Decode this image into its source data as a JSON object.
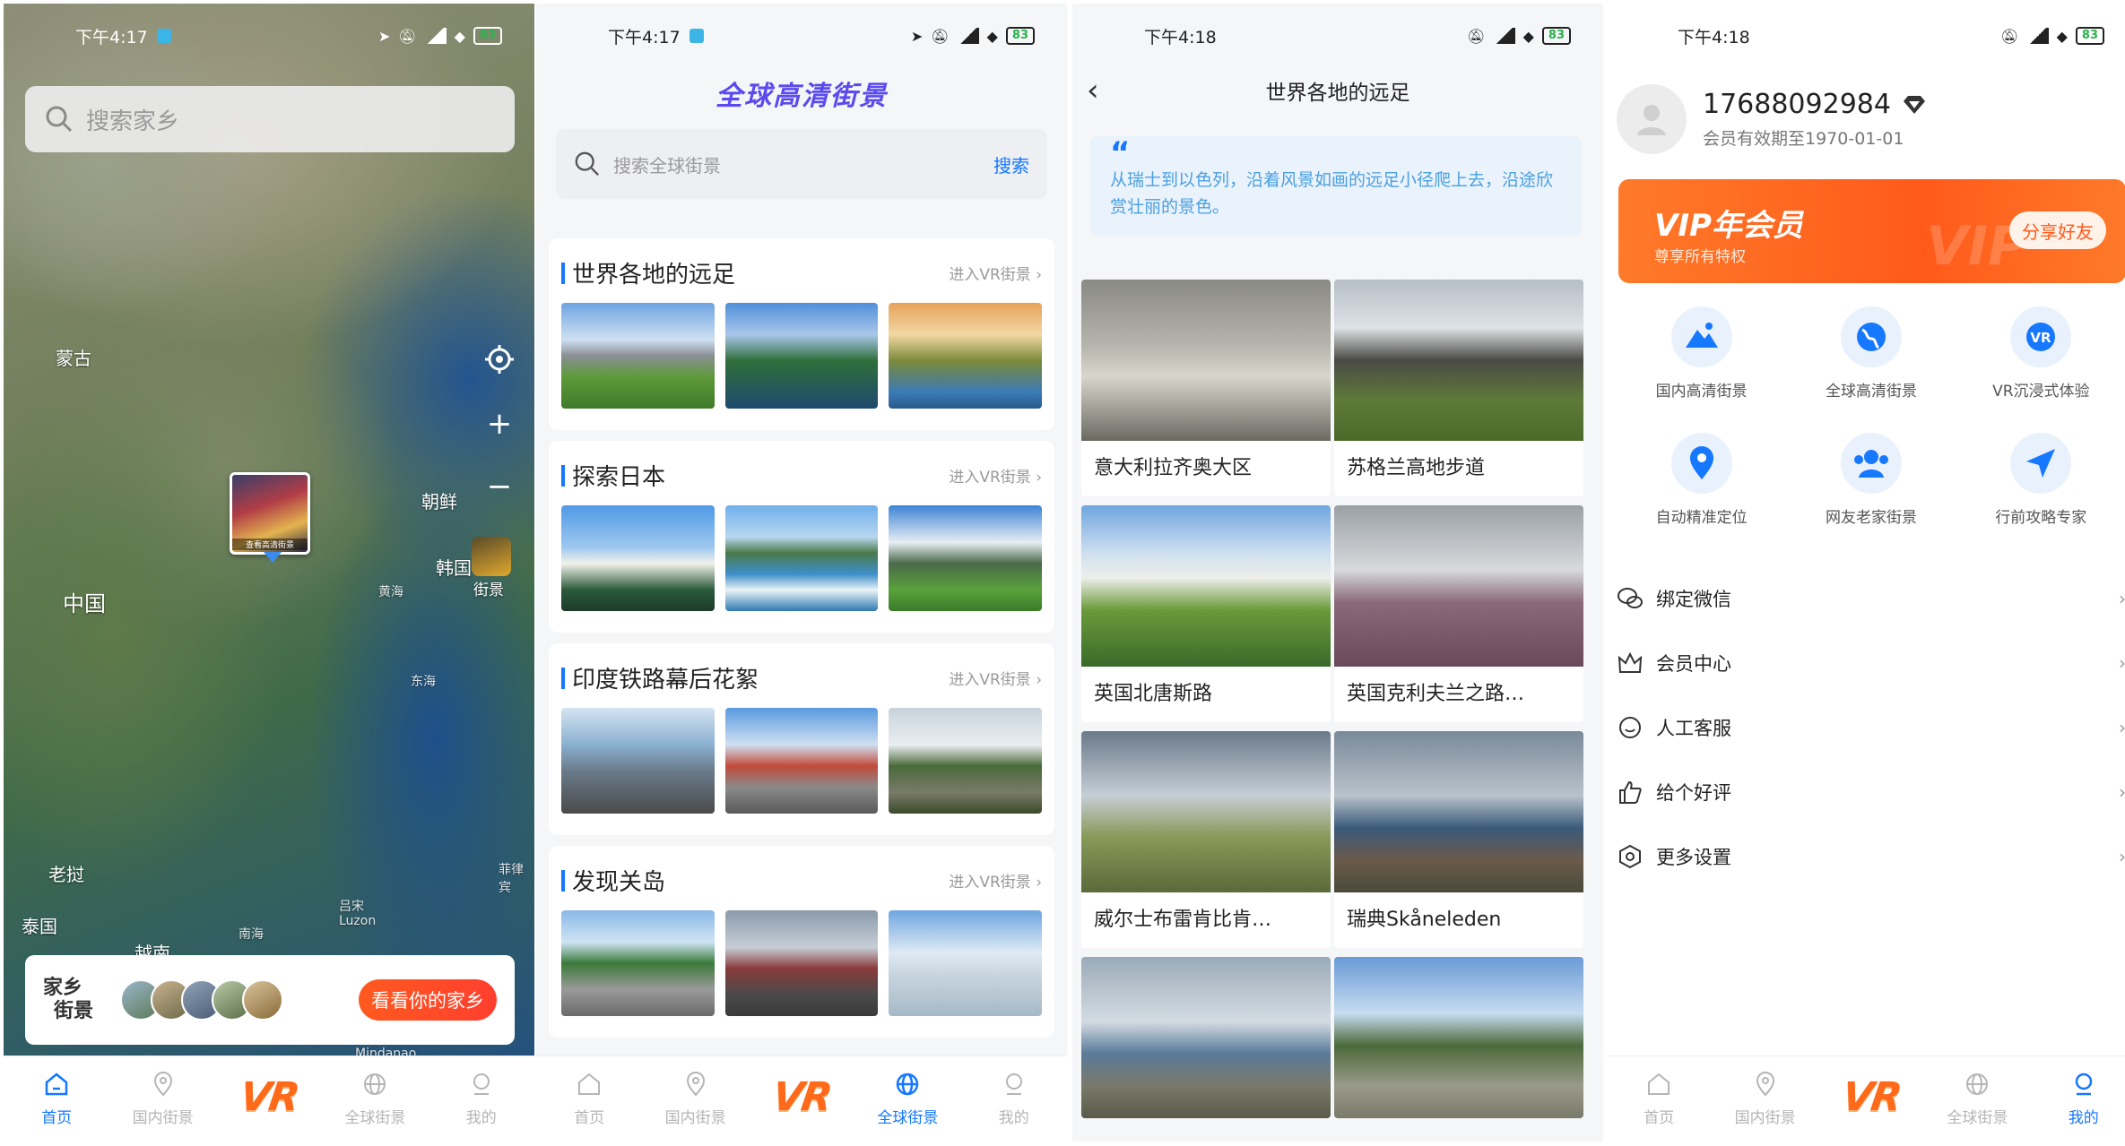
{
  "colors": {
    "accent": "#1677ff",
    "vr_orange": "#ff6a1a",
    "vip_orange": "#ff5a1a",
    "inactive": "#b5b5b5"
  },
  "tabbar": {
    "home": "首页",
    "domestic": "国内街景",
    "vr": "VR",
    "global": "全球街景",
    "mine": "我的"
  },
  "phone1": {
    "status": {
      "time": "下午4:17",
      "battery": "83"
    },
    "search": {
      "placeholder": "搜索家乡"
    },
    "map_labels": {
      "mongolia": "蒙古",
      "china": "中国",
      "korea_n": "朝鲜",
      "korea_s": "韩国",
      "yellow_sea": "黄海",
      "east_sea": "东海",
      "laos": "老挝",
      "thailand": "泰国",
      "vietnam": "越南",
      "south_sea": "南海",
      "luzon": "吕宋\nLuzon",
      "philippines": "菲律宾",
      "mindanao": "Mindanao",
      "street": "街景"
    },
    "pin_caption": "查看高清街景",
    "home_card": {
      "logo_line1": "家乡",
      "logo_line2": "街景",
      "button": "看看你的家乡"
    }
  },
  "phone2": {
    "status": {
      "time": "下午4:17",
      "battery": "83"
    },
    "title": "全球高清街景",
    "search": {
      "placeholder": "搜索全球街景",
      "button": "搜索"
    },
    "enter_label": "进入VR街景 ›",
    "sections": [
      {
        "name": "世界各地的远足"
      },
      {
        "name": "探索日本"
      },
      {
        "name": "印度铁路幕后花絮"
      },
      {
        "name": "发现关岛"
      }
    ]
  },
  "phone3": {
    "status": {
      "time": "下午4:18",
      "battery": "83"
    },
    "title": "世界各地的远足",
    "quote": "从瑞士到以色列，沿着风景如画的远足小径爬上去，沿途欣赏壮丽的景色。",
    "cards": [
      {
        "label": "意大利拉齐奥大区"
      },
      {
        "label": "苏格兰高地步道"
      },
      {
        "label": "英国北唐斯路"
      },
      {
        "label": "英国克利夫兰之路…"
      },
      {
        "label": "威尔士布雷肯比肯…"
      },
      {
        "label": "瑞典Skåneleden"
      },
      {
        "label": ""
      },
      {
        "label": ""
      }
    ]
  },
  "phone4": {
    "status": {
      "time": "下午4:18",
      "battery": "83"
    },
    "phone_number": "17688092984",
    "expiry": "会员有效期至1970-01-01",
    "vip": {
      "title": "VIP年会员",
      "subtitle": "尊享所有特权",
      "share": "分享好友",
      "ghost": "VIP"
    },
    "features": [
      {
        "label": "国内高清街景",
        "icon": "mountain-icon"
      },
      {
        "label": "全球高清街景",
        "icon": "globe-icon"
      },
      {
        "label": "VR沉浸式体验",
        "icon": "vr-icon"
      },
      {
        "label": "自动精准定位",
        "icon": "location-pin-icon"
      },
      {
        "label": "网友老家街景",
        "icon": "users-icon"
      },
      {
        "label": "行前攻略专家",
        "icon": "paper-plane-icon"
      }
    ],
    "menu": [
      {
        "label": "绑定微信",
        "icon": "wechat-icon"
      },
      {
        "label": "会员中心",
        "icon": "crown-icon"
      },
      {
        "label": "人工客服",
        "icon": "service-icon"
      },
      {
        "label": "给个好评",
        "icon": "thumbs-up-icon"
      },
      {
        "label": "更多设置",
        "icon": "settings-icon"
      }
    ]
  }
}
